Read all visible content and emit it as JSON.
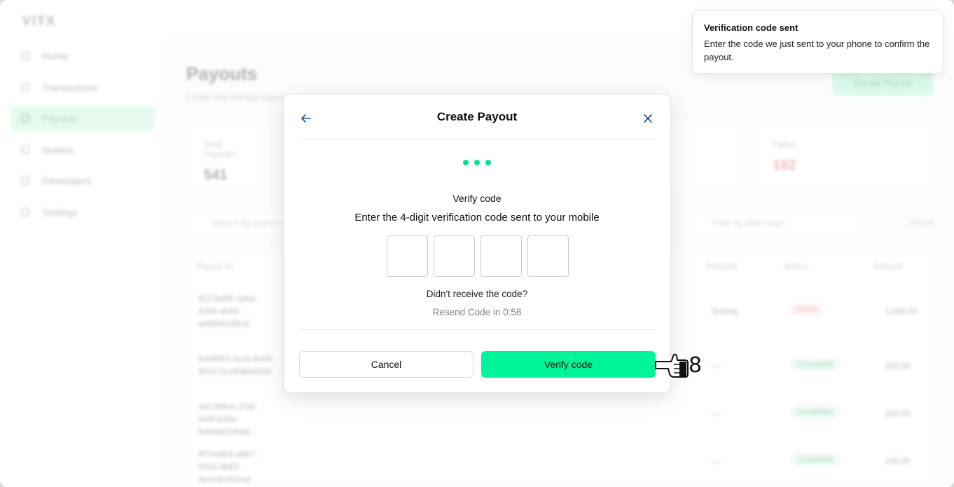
{
  "app": {
    "logo": "VITX",
    "sidebar": [
      {
        "label": "Home",
        "active": false
      },
      {
        "label": "Transactions",
        "active": false
      },
      {
        "label": "Payouts",
        "active": true
      },
      {
        "label": "Wallets",
        "active": false
      },
      {
        "label": "Developers",
        "active": false
      },
      {
        "label": "Settings",
        "active": false
      }
    ],
    "page_title": "Payouts",
    "page_subtitle": "Create and manage payouts",
    "create_button": "Create Payout",
    "stats": [
      {
        "label": "Total Payouts",
        "value": "541",
        "status": "normal"
      },
      {
        "label": "Failed",
        "value": "182",
        "status": "failed"
      }
    ],
    "search_placeholder": "Search by payout ID",
    "date_placeholder": "Filter by date range",
    "reset_label": "Reset",
    "table": {
      "headers": [
        "Payout ID",
        "Purpose",
        "Status",
        "Amount"
      ],
      "rows": [
        {
          "id": "8123a4f6-1bbd-4396-ab68-ad6f9424f5c6",
          "purpose": "Testing",
          "status": "Failed",
          "amount": "1,000.00"
        },
        {
          "id": "9d4f5f01-fa15-4e85-9041-f1a4f4b6a06b",
          "purpose": "—",
          "status": "Completed",
          "amount": "100.00"
        },
        {
          "id": "a9128dce-2f18-4e0f-b26e-9d4eb61f4a9c",
          "purpose": "—",
          "status": "Completed",
          "amount": "100.00"
        },
        {
          "id": "8f74a9b5-d6b7-4316-9b82-3ecc9e4f1eae",
          "purpose": "—",
          "status": "Completed",
          "amount": "100.00"
        }
      ]
    }
  },
  "toast": {
    "title": "Verification code sent",
    "message": "Enter the code we just sent to your phone to confirm the payout."
  },
  "modal": {
    "title": "Create Payout",
    "step_label": "Verify code",
    "description": "Enter the 4-digit verification code sent to your mobile",
    "code_digits": [
      "",
      "",
      "",
      ""
    ],
    "didnt_receive": "Didn't receive the code?",
    "resend": "Resend Code in 0:58",
    "cancel_label": "Cancel",
    "verify_label": "Verify code"
  },
  "cursor": {
    "step_number": "8"
  },
  "colors": {
    "accent": "#00f59a",
    "dot": "#00e38d",
    "failed": "#e84a4a"
  }
}
